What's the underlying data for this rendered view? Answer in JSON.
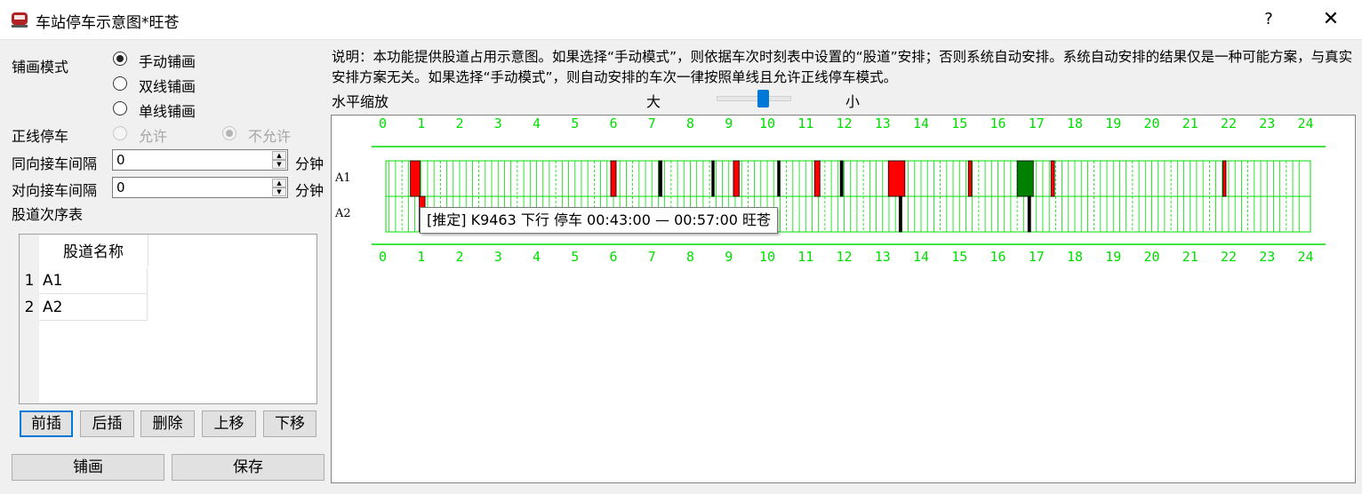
{
  "window": {
    "title": "车站停车示意图*旺苍",
    "help": "?",
    "close": "✕"
  },
  "left": {
    "mode_label": "铺画模式",
    "modes": [
      {
        "label": "手动铺画",
        "checked": true
      },
      {
        "label": "双线铺画",
        "checked": false
      },
      {
        "label": "单线铺画",
        "checked": false
      }
    ],
    "mainline_label": "正线停车",
    "mainline_allow": "允许",
    "mainline_deny": "不允许",
    "same_dir_label": "同向接车间隔",
    "same_dir_value": "0",
    "opp_dir_label": "对向接车间隔",
    "opp_dir_value": "0",
    "unit": "分钟",
    "table_label": "股道次序表",
    "table": {
      "header": "股道名称",
      "rows": [
        {
          "num": "1",
          "name": "A1"
        },
        {
          "num": "2",
          "name": "A2"
        }
      ]
    },
    "buttons": [
      "前插",
      "后插",
      "删除",
      "上移",
      "下移"
    ],
    "draw_button": "铺画",
    "save_button": "保存"
  },
  "right": {
    "description": "说明：本功能提供股道占用示意图。如果选择“手动模式”，则依据车次时刻表中设置的“股道”安排；否则系统自动安排。系统自动安排的结果仅是一种可能方案，与真实安排方案无关。如果选择“手动模式”，则自动安排的车次一律按照单线且允许正线停车模式。",
    "zoom_label": "水平缩放",
    "zoom_large": "大",
    "zoom_small": "小",
    "zoom_level": 0.6
  },
  "chart_data": {
    "type": "timeline",
    "hours": [
      "0",
      "1",
      "2",
      "3",
      "4",
      "5",
      "6",
      "7",
      "8",
      "9",
      "10",
      "11",
      "12",
      "13",
      "14",
      "15",
      "16",
      "17",
      "18",
      "19",
      "20",
      "21",
      "22",
      "23",
      "24"
    ],
    "tracks": [
      "A1",
      "A2"
    ],
    "colors": {
      "grid": "#00dd00",
      "red": "#ff0000",
      "green": "#008000",
      "black": "#000000"
    },
    "occupancies": [
      {
        "track": "A1",
        "start": 0.72,
        "end": 0.97,
        "color": "red"
      },
      {
        "track": "A2",
        "start": 0.95,
        "end": 1.1,
        "color": "red"
      },
      {
        "track": "A1",
        "start": 5.93,
        "end": 6.07,
        "color": "red"
      },
      {
        "track": "A1",
        "start": 7.18,
        "end": 7.26,
        "color": "black"
      },
      {
        "track": "A1",
        "start": 8.56,
        "end": 8.62,
        "color": "black"
      },
      {
        "track": "A1",
        "start": 9.12,
        "end": 9.27,
        "color": "red"
      },
      {
        "track": "A1",
        "start": 10.27,
        "end": 10.33,
        "color": "black"
      },
      {
        "track": "A1",
        "start": 11.23,
        "end": 11.37,
        "color": "red"
      },
      {
        "track": "A1",
        "start": 11.9,
        "end": 11.97,
        "color": "black"
      },
      {
        "track": "A1",
        "start": 13.15,
        "end": 13.58,
        "color": "red"
      },
      {
        "track": "A2",
        "start": 13.43,
        "end": 13.5,
        "color": "black"
      },
      {
        "track": "A1",
        "start": 15.23,
        "end": 15.32,
        "color": "red"
      },
      {
        "track": "A1",
        "start": 16.5,
        "end": 16.92,
        "color": "green"
      },
      {
        "track": "A2",
        "start": 16.78,
        "end": 16.85,
        "color": "black"
      },
      {
        "track": "A1",
        "start": 17.38,
        "end": 17.47,
        "color": "red"
      },
      {
        "track": "A1",
        "start": 21.85,
        "end": 21.93,
        "color": "red"
      }
    ],
    "tooltip": "[推定] K9463 下行 停车  00:43:00 — 00:57:00 旺苍"
  }
}
